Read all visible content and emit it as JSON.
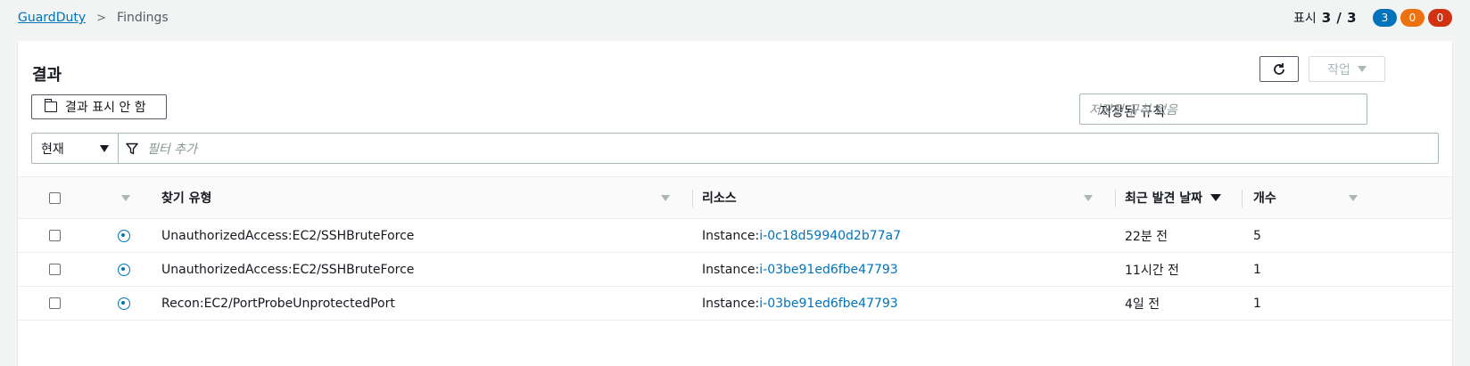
{
  "breadcrumb": {
    "root": "GuardDuty",
    "current": "Findings"
  },
  "counter": {
    "label": "표시",
    "value": "3 / 3",
    "badges": [
      {
        "value": "3",
        "color": "#0073bb"
      },
      {
        "value": "0",
        "color": "#ec7211"
      },
      {
        "value": "0",
        "color": "#d13212"
      }
    ]
  },
  "panel": {
    "title": "결과",
    "actions_label": "작업",
    "suppress_label": "결과 표시 안 함",
    "saved_rules_label": "저장된 규칙",
    "saved_rules_placeholder": "저장된 규칙 없음",
    "filter_select_value": "현재",
    "filter_placeholder": "필터 추가"
  },
  "table": {
    "headers": {
      "finding_type": "찾기 유형",
      "resource": "리소스",
      "last_seen": "최근 발견 날짜",
      "count": "개수"
    },
    "rows": [
      {
        "finding_type": "UnauthorizedAccess:EC2/SSHBruteForce",
        "resource_prefix": "Instance: ",
        "resource_id": "i-0c18d59940d2b77a7",
        "last_seen": "22분 전",
        "count": "5"
      },
      {
        "finding_type": "UnauthorizedAccess:EC2/SSHBruteForce",
        "resource_prefix": "Instance: ",
        "resource_id": "i-03be91ed6fbe47793",
        "last_seen": "11시간 전",
        "count": "1"
      },
      {
        "finding_type": "Recon:EC2/PortProbeUnprotectedPort",
        "resource_prefix": "Instance: ",
        "resource_id": "i-03be91ed6fbe47793",
        "last_seen": "4일 전",
        "count": "1"
      }
    ]
  },
  "icons": {
    "severity": "low-severity-icon",
    "refresh": "refresh-icon",
    "filter": "funnel-icon",
    "folder": "folder-icon"
  }
}
